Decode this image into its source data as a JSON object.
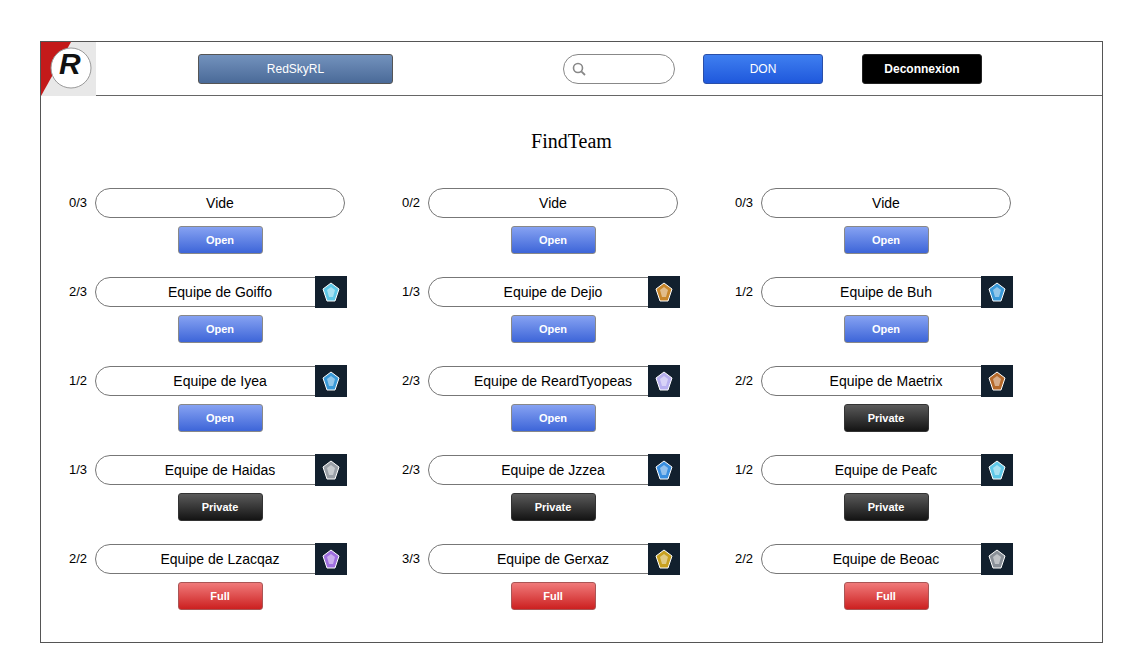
{
  "header": {
    "logo": "R",
    "brand": "RedSkyRL",
    "donate": "DON",
    "logout": "Deconnexion"
  },
  "title": "FindTeam",
  "teams": [
    {
      "count": "0/3",
      "name": "Vide",
      "status": "Open",
      "kind": "open",
      "color": null
    },
    {
      "count": "0/2",
      "name": "Vide",
      "status": "Open",
      "kind": "open",
      "color": null
    },
    {
      "count": "0/3",
      "name": "Vide",
      "status": "Open",
      "kind": "open",
      "color": null
    },
    {
      "count": "2/3",
      "name": "Equipe de Goiffo",
      "status": "Open",
      "kind": "open",
      "color": "#5fc8e8"
    },
    {
      "count": "1/3",
      "name": "Equipe de Dejio",
      "status": "Open",
      "kind": "open",
      "color": "#c8862a"
    },
    {
      "count": "1/2",
      "name": "Equipe de Buh",
      "status": "Open",
      "kind": "open",
      "color": "#3a9ad9"
    },
    {
      "count": "1/2",
      "name": "Equipe de Iyea",
      "status": "Open",
      "kind": "open",
      "color": "#3a9ad9"
    },
    {
      "count": "2/3",
      "name": "Equipe de ReardTyopeas",
      "status": "Open",
      "kind": "open",
      "color": "#b8b0f0"
    },
    {
      "count": "2/2",
      "name": "Equipe de Maetrix",
      "status": "Private",
      "kind": "private",
      "color": "#b5692a"
    },
    {
      "count": "1/3",
      "name": "Equipe de Haidas",
      "status": "Private",
      "kind": "private",
      "color": "#9aa0a8"
    },
    {
      "count": "2/3",
      "name": "Equipe de Jzzea",
      "status": "Private",
      "kind": "private",
      "color": "#3a8fe0"
    },
    {
      "count": "1/2",
      "name": "Equipe de Peafc",
      "status": "Private",
      "kind": "private",
      "color": "#5fc8e8"
    },
    {
      "count": "2/2",
      "name": "Equipe de Lzacqaz",
      "status": "Full",
      "kind": "full",
      "color": "#a070e0"
    },
    {
      "count": "3/3",
      "name": "Equipe de Gerxaz",
      "status": "Full",
      "kind": "full",
      "color": "#c8a020"
    },
    {
      "count": "2/2",
      "name": "Equipe de Beoac",
      "status": "Full",
      "kind": "full",
      "color": "#8a9098"
    }
  ]
}
